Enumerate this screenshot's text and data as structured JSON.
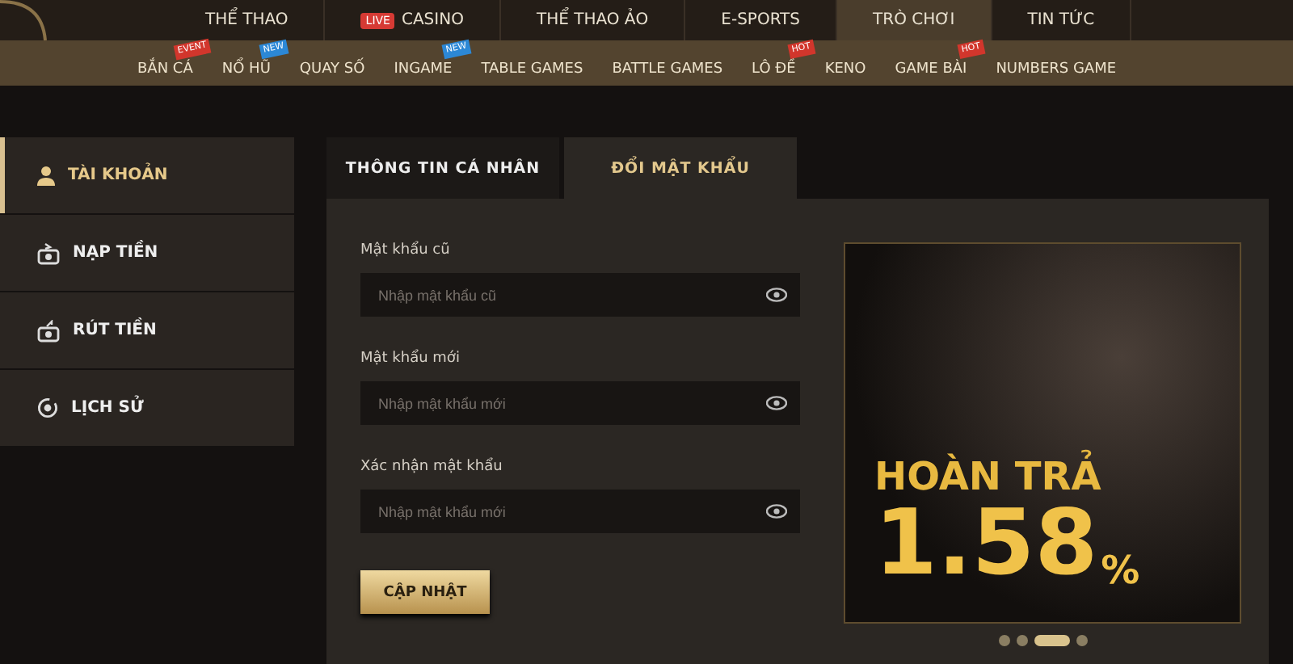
{
  "top_nav": [
    {
      "label": "THỂ THAO",
      "selected": false
    },
    {
      "label": "CASINO",
      "badge": "LIVE",
      "selected": false
    },
    {
      "label": "THỂ THAO ẢO",
      "selected": false
    },
    {
      "label": "E-SPORTS",
      "selected": false
    },
    {
      "label": "TRÒ CHƠI",
      "selected": true
    },
    {
      "label": "TIN TỨC",
      "selected": false
    }
  ],
  "sub_nav": [
    {
      "label": "BẮN CÁ",
      "badge": "EVENT",
      "color": "#d2362c"
    },
    {
      "label": "NỔ HŨ",
      "badge": "NEW",
      "color": "#2c88d6"
    },
    {
      "label": "QUAY SỐ"
    },
    {
      "label": "INGAME",
      "badge": "NEW",
      "color": "#2c88d6"
    },
    {
      "label": "TABLE GAMES"
    },
    {
      "label": "BATTLE GAMES"
    },
    {
      "label": "LÔ ĐỀ",
      "badge": "HOT",
      "color": "#d2362c"
    },
    {
      "label": "KENO"
    },
    {
      "label": "GAME BÀI",
      "badge": "HOT",
      "color": "#d2362c"
    },
    {
      "label": "NUMBERS GAME"
    }
  ],
  "sidebar": [
    {
      "label": "TÀI KHOẢN",
      "kind": "user",
      "selected": true
    },
    {
      "label": "NẠP TIỀN",
      "kind": "deposit",
      "selected": false
    },
    {
      "label": "RÚT TIỀN",
      "kind": "withdraw",
      "selected": false
    },
    {
      "label": "LỊCH SỬ",
      "kind": "history",
      "selected": false
    }
  ],
  "tabs": [
    {
      "label": "THÔNG TIN CÁ NHÂN",
      "selected": false
    },
    {
      "label": "ĐỔI MẬT KHẨU",
      "selected": true
    }
  ],
  "form": {
    "fields": [
      {
        "label": "Mật khẩu cũ",
        "placeholder": "Nhập mật khẩu cũ"
      },
      {
        "label": "Mật khẩu mới",
        "placeholder": "Nhập mật khẩu mới"
      },
      {
        "label": "Xác nhận mật khẩu",
        "placeholder": "Nhập mật khẩu mới"
      }
    ],
    "submit": "CẬP NHẬT"
  },
  "banner": {
    "headline": "HOÀN TRẢ",
    "figure": "1.58",
    "unit": "%",
    "slides": [
      {
        "selected": false
      },
      {
        "selected": false
      },
      {
        "selected": true
      },
      {
        "selected": false
      }
    ]
  }
}
